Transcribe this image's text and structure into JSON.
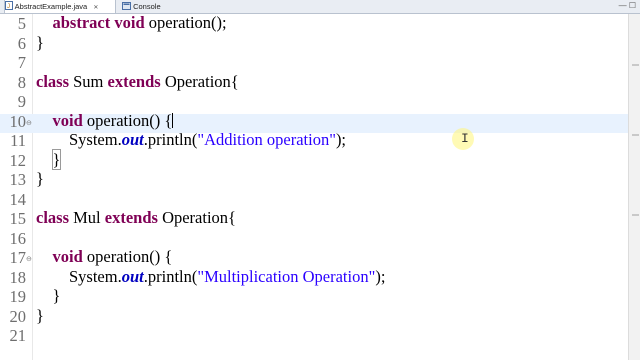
{
  "tabs": [
    {
      "label": "AbstractExample.java",
      "close": "✕"
    },
    {
      "label": "Console"
    }
  ],
  "window_controls": "— ☐",
  "lines": [
    {
      "num": "5",
      "parts": [
        [
          "",
          "    "
        ],
        [
          "kw",
          "abstract"
        ],
        [
          "",
          " "
        ],
        [
          "kw",
          "void"
        ],
        [
          "",
          " operation();"
        ]
      ]
    },
    {
      "num": "6",
      "parts": [
        [
          "",
          "}"
        ]
      ]
    },
    {
      "num": "7",
      "parts": [
        [
          "",
          ""
        ]
      ]
    },
    {
      "num": "8",
      "parts": [
        [
          "kw",
          "class"
        ],
        [
          "",
          " Sum "
        ],
        [
          "kw",
          "extends"
        ],
        [
          "",
          " Operation{"
        ]
      ]
    },
    {
      "num": "9",
      "parts": [
        [
          "",
          ""
        ]
      ]
    },
    {
      "num": "10",
      "parts": [
        [
          "",
          "    "
        ],
        [
          "kw",
          "void"
        ],
        [
          "",
          " operation() {"
        ]
      ],
      "current": true,
      "fold": "⊖",
      "caret": true
    },
    {
      "num": "11",
      "parts": [
        [
          "",
          "        System."
        ],
        [
          "it",
          "out"
        ],
        [
          "",
          ".println("
        ],
        [
          "str",
          "\"Addition operation\""
        ],
        [
          "",
          ");"
        ]
      ]
    },
    {
      "num": "12",
      "parts": [
        [
          "",
          "    "
        ],
        [
          "box",
          "}"
        ]
      ]
    },
    {
      "num": "13",
      "parts": [
        [
          "",
          "}"
        ]
      ]
    },
    {
      "num": "14",
      "parts": [
        [
          "",
          ""
        ]
      ]
    },
    {
      "num": "15",
      "parts": [
        [
          "kw",
          "class"
        ],
        [
          "",
          " Mul "
        ],
        [
          "kw",
          "extends"
        ],
        [
          "",
          " Operation{"
        ]
      ]
    },
    {
      "num": "16",
      "parts": [
        [
          "",
          ""
        ]
      ]
    },
    {
      "num": "17",
      "parts": [
        [
          "",
          "    "
        ],
        [
          "kw",
          "void"
        ],
        [
          "",
          " operation() {"
        ]
      ],
      "fold": "⊖"
    },
    {
      "num": "18",
      "parts": [
        [
          "",
          "        System."
        ],
        [
          "it",
          "out"
        ],
        [
          "",
          ".println("
        ],
        [
          "str",
          "\"Multiplication Operation\""
        ],
        [
          "",
          ");"
        ]
      ]
    },
    {
      "num": "19",
      "parts": [
        [
          "",
          "    }"
        ]
      ]
    },
    {
      "num": "20",
      "parts": [
        [
          "",
          "}"
        ]
      ]
    },
    {
      "num": "21",
      "parts": [
        [
          "",
          ""
        ]
      ]
    }
  ]
}
